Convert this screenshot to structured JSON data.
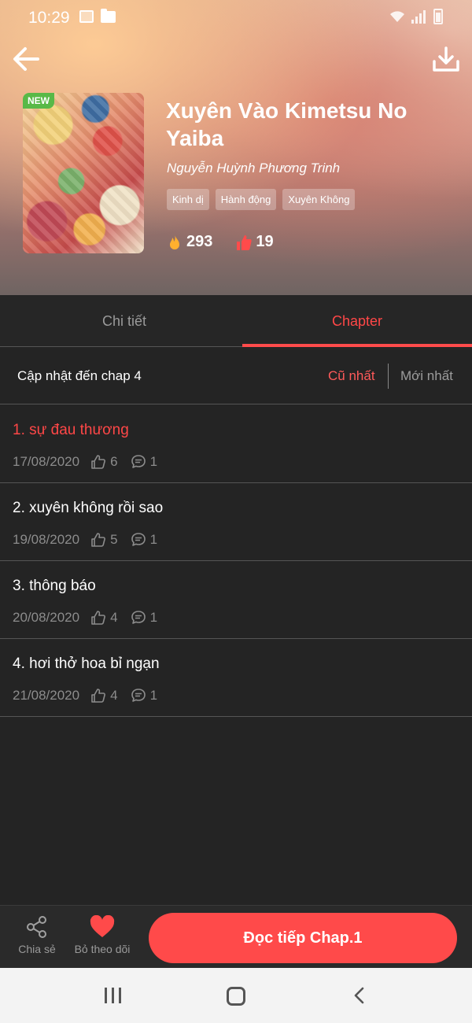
{
  "status_bar": {
    "time": "10:29"
  },
  "header": {
    "badge": "NEW",
    "title": "Xuyên Vào Kimetsu No Yaiba",
    "author": "Nguyễn Huỳnh Phương Trinh",
    "tags": [
      "Kinh dị",
      "Hành động",
      "Xuyên Không"
    ],
    "views": "293",
    "likes": "19",
    "colors": {
      "fire": "#ffb02e",
      "like": "#ff4b4b"
    }
  },
  "tabs": [
    {
      "label": "Chi tiết",
      "active": false
    },
    {
      "label": "Chapter",
      "active": true
    }
  ],
  "sort": {
    "update_text": "Cập nhật đến chap 4",
    "oldest": "Cũ nhất",
    "newest": "Mới nhất"
  },
  "chapters": [
    {
      "title": "1. sự đau thương",
      "date": "17/08/2020",
      "likes": "6",
      "comments": "1",
      "active": true
    },
    {
      "title": "2. xuyên không rồi sao",
      "date": "19/08/2020",
      "likes": "5",
      "comments": "1",
      "active": false
    },
    {
      "title": "3. thông báo",
      "date": "20/08/2020",
      "likes": "4",
      "comments": "1",
      "active": false
    },
    {
      "title": "4. hơi thở hoa bỉ ngạn",
      "date": "21/08/2020",
      "likes": "4",
      "comments": "1",
      "active": false
    }
  ],
  "action_bar": {
    "share_label": "Chia sẻ",
    "follow_label": "Bỏ theo dõi",
    "continue_label": "Đọc tiếp Chap.1"
  },
  "theme": {
    "accent": "#ff4a4a",
    "background": "#242424"
  }
}
